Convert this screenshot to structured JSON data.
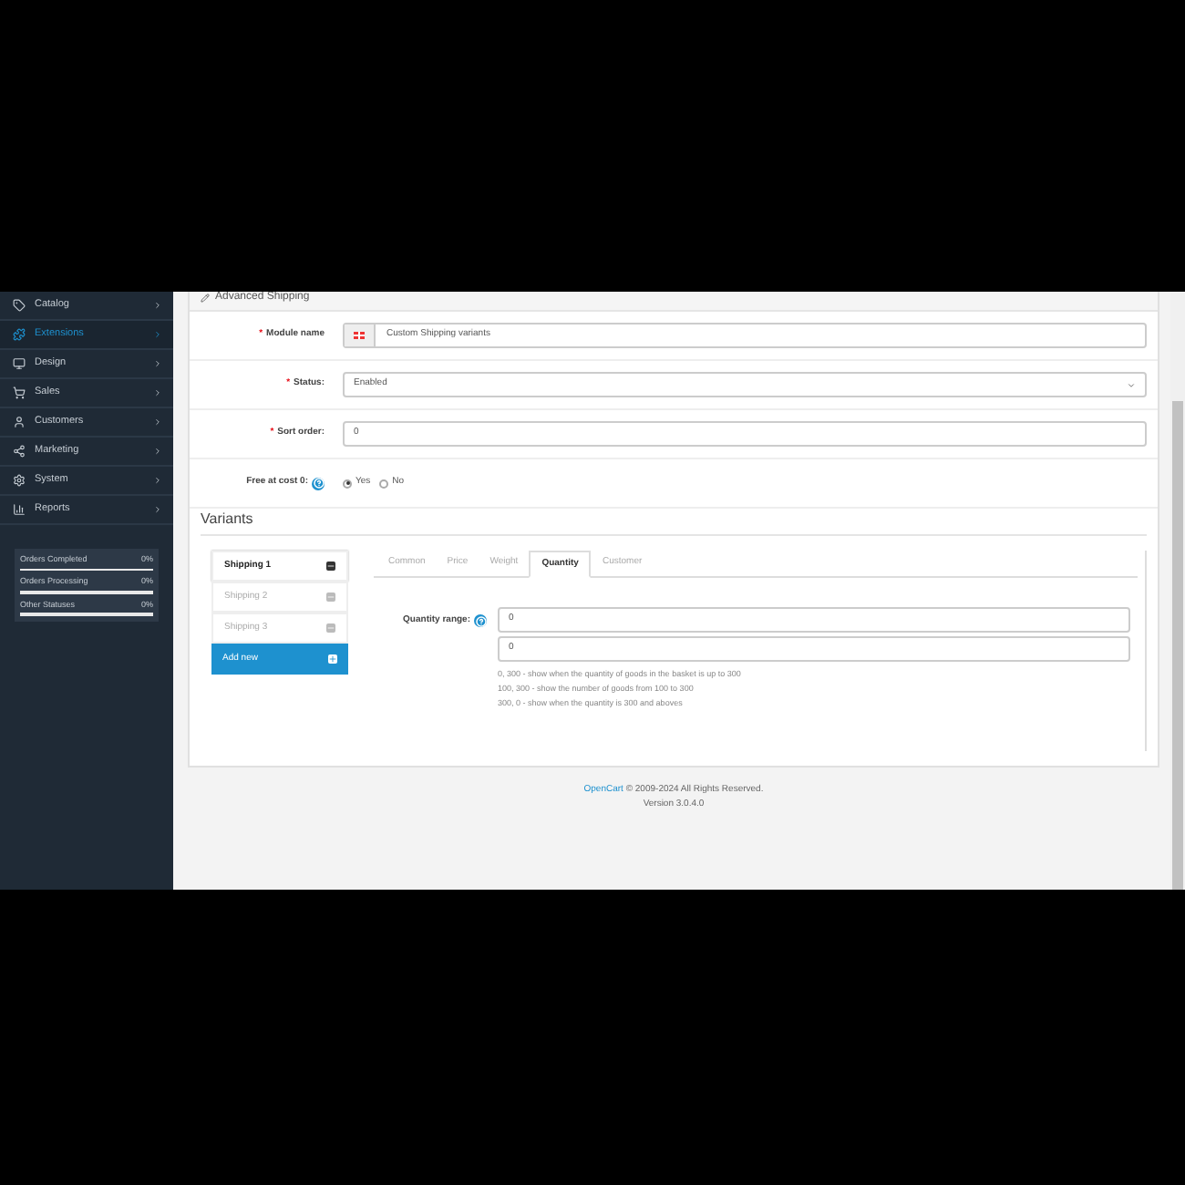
{
  "sidebar": {
    "items": [
      {
        "label": "Catalog",
        "selected": false
      },
      {
        "label": "Extensions",
        "selected": true
      },
      {
        "label": "Design",
        "selected": false
      },
      {
        "label": "Sales",
        "selected": false
      },
      {
        "label": "Customers",
        "selected": false
      },
      {
        "label": "Marketing",
        "selected": false
      },
      {
        "label": "System",
        "selected": false
      },
      {
        "label": "Reports",
        "selected": false
      }
    ],
    "stats": [
      {
        "label": "Orders Completed",
        "reading": "0%"
      },
      {
        "label": "Orders Processing",
        "reading": "0%"
      },
      {
        "label": "Other Statuses",
        "reading": "0%"
      }
    ]
  },
  "panel": {
    "title": "Advanced Shipping",
    "fields": [
      {
        "kind": "flag-text",
        "mark": "*",
        "label": "Module name",
        "value": "Custom Shipping variants"
      },
      {
        "kind": "select",
        "mark": "*",
        "label": "Status:",
        "value": "Enabled"
      },
      {
        "kind": "text",
        "mark": "*",
        "label": "Sort order:",
        "value": "0"
      },
      {
        "kind": "radio",
        "label": "Free at cost 0:",
        "options": [
          {
            "label": "Yes",
            "selected": true
          },
          {
            "label": "No",
            "selected": false
          }
        ]
      }
    ],
    "variants": {
      "title": "Variants",
      "items": [
        {
          "label": "Shipping 1",
          "selected": true
        },
        {
          "label": "Shipping 2",
          "selected": false
        },
        {
          "label": "Shipping 3",
          "selected": false
        }
      ],
      "add_button": "Add new",
      "tabs": [
        {
          "label": "Common",
          "selected": false
        },
        {
          "label": "Price",
          "selected": false
        },
        {
          "label": "Weight",
          "selected": false
        },
        {
          "label": "Quantity",
          "selected": true
        },
        {
          "label": "Customer",
          "selected": false
        }
      ],
      "range_label": "Quantity range:",
      "range_values": [
        "0",
        "0"
      ],
      "hints": [
        "0, 300 - show when the quantity of goods in the basket is up to 300",
        "100, 300 - show the number of goods from 100 to 300",
        "300, 0 - show when the quantity is 300 and aboves"
      ]
    }
  },
  "footer": {
    "link": "OpenCart",
    "text": "© 2009-2024 All Rights Reserved.",
    "version": "Version 3.0.4.0"
  }
}
